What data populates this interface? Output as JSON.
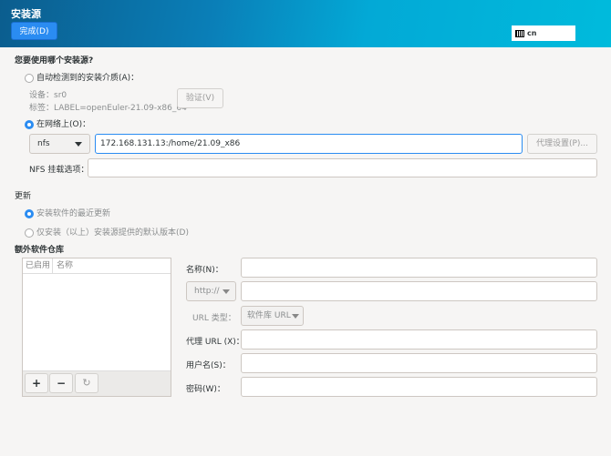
{
  "header": {
    "title": "安装源",
    "done_label": "完成(D)",
    "keyboard_layout": "cn"
  },
  "source": {
    "heading": "您要使用哪个安装源?",
    "auto_label": "自动检测到的安装介质(A)：",
    "auto_selected": false,
    "device_text": "设备：sr0",
    "label_text": "标签：LABEL=openEuler-21.09-x86_64",
    "verify_label": "验证(V)",
    "network_label": "在网络上(O)：",
    "network_selected": true,
    "protocol": "nfs",
    "url_value": "172.168.131.13:/home/21.09_x86",
    "proxy_label": "代理设置(P)...",
    "nfs_options_label": "NFS 挂载选项：",
    "nfs_options_value": ""
  },
  "updates": {
    "heading": "更新",
    "opt1": "安装软件的最近更新",
    "opt1_selected": true,
    "opt2": "仅安装（以上）安装源提供的默认版本(D)",
    "opt2_selected": false
  },
  "repos": {
    "heading": "额外软件仓库",
    "col_enabled": "已启用",
    "col_name": "名称",
    "add": "+",
    "remove": "−",
    "name_label": "名称(N)：",
    "protocol": "http://",
    "url_type_label": "URL 类型：",
    "url_type": "软件库 URL",
    "proxy_url_label": "代理 URL (X)：",
    "username_label": "用户名(S)：",
    "password_label": "密码(W)："
  },
  "colors": {
    "accent": "#2a8cf2",
    "background": "#f6f5f4"
  }
}
